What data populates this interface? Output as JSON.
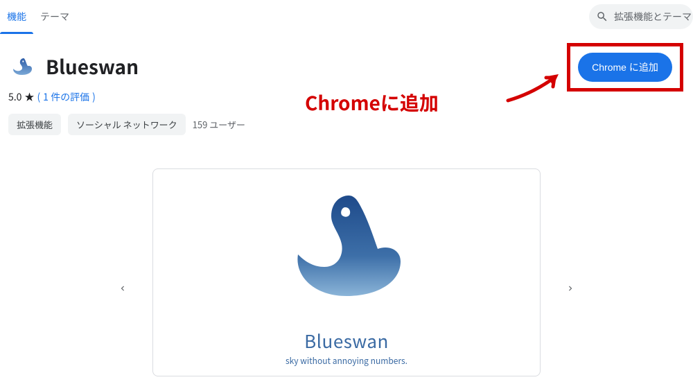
{
  "tabs": {
    "extensions": "機能",
    "themes": "テーマ"
  },
  "search": {
    "placeholder": "拡張機能とテーマ"
  },
  "app": {
    "title": "Blueswan",
    "rating_value": "5.0",
    "rating_star": "★",
    "rating_link_prefix": "(",
    "rating_link_text": "1 件の評価",
    "rating_link_suffix": ")"
  },
  "chips": {
    "extension": "拡張機能",
    "category": "ソーシャル ネットワーク"
  },
  "users": "159 ユーザー",
  "install_button": "Chrome に追加",
  "annotation_text": "Chromeに追加",
  "gallery": {
    "logo_title": "Blueswan",
    "logo_subtitle": "sky without annoying numbers."
  }
}
